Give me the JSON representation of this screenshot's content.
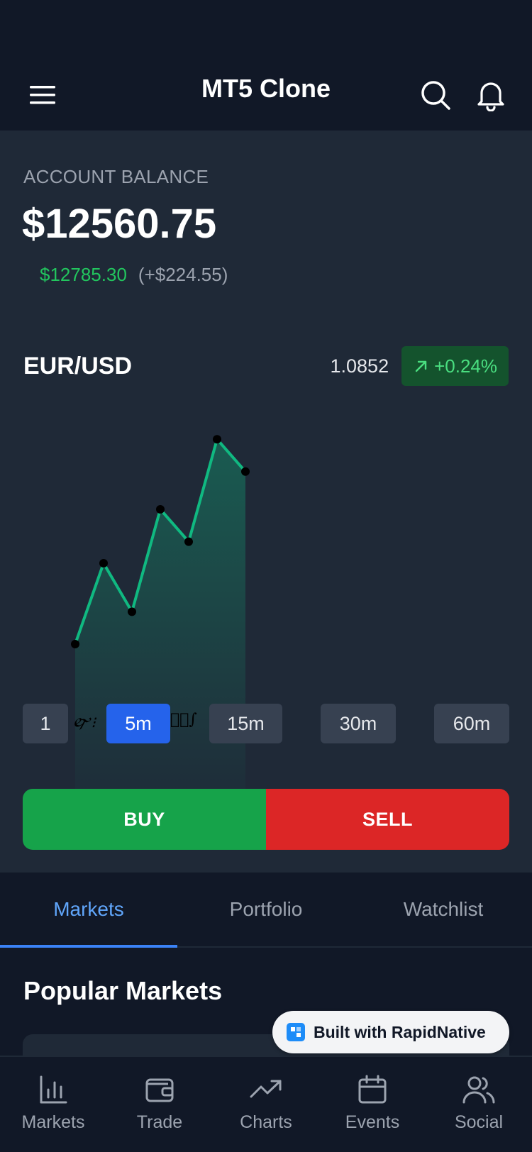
{
  "app": {
    "title": "MT5 Clone"
  },
  "header": {
    "menu_icon": "menu-icon",
    "search_icon": "search-icon",
    "notification_icon": "bell-icon"
  },
  "account": {
    "label": "ACCOUNT BALANCE",
    "balance": "$12560.75",
    "equity": "$12785.30",
    "equity_diff": "(+$224.55)"
  },
  "pair": {
    "name": "EUR/USD",
    "price": "1.0852",
    "change": "+0.24%",
    "change_icon": "arrow-up-right-icon"
  },
  "chart_data": {
    "type": "area",
    "series": [
      {
        "values": [
          1.0,
          2.5,
          1.6,
          3.5,
          2.9,
          4.8,
          4.2
        ]
      }
    ],
    "ylim": [
      0,
      5
    ],
    "grid": false,
    "colors": {
      "line": "#10b981",
      "fill": "#10b981",
      "point": "#000000"
    }
  },
  "timeframes": [
    {
      "label": "1",
      "active": false
    },
    {
      "label": "5m",
      "active": true
    },
    {
      "label": "15m",
      "active": false
    },
    {
      "label": "30m",
      "active": false
    },
    {
      "label": "60m",
      "active": false
    }
  ],
  "trade": {
    "buy_label": "BUY",
    "sell_label": "SELL"
  },
  "tabs": [
    {
      "label": "Markets",
      "active": true
    },
    {
      "label": "Portfolio",
      "active": false
    },
    {
      "label": "Watchlist",
      "active": false
    }
  ],
  "markets_section": {
    "title": "Popular Markets"
  },
  "badge": {
    "label": "Built with RapidNative"
  },
  "bottom_nav": [
    {
      "label": "Markets",
      "icon": "bar-chart-icon"
    },
    {
      "label": "Trade",
      "icon": "wallet-icon"
    },
    {
      "label": "Charts",
      "icon": "trending-up-icon"
    },
    {
      "label": "Events",
      "icon": "calendar-icon"
    },
    {
      "label": "Social",
      "icon": "users-icon"
    }
  ],
  "colors": {
    "background": "#1f2937",
    "header": "#111827",
    "accent": "#2563eb",
    "positive": "#22c55e",
    "buy": "#16a34a",
    "sell": "#dc2626"
  }
}
